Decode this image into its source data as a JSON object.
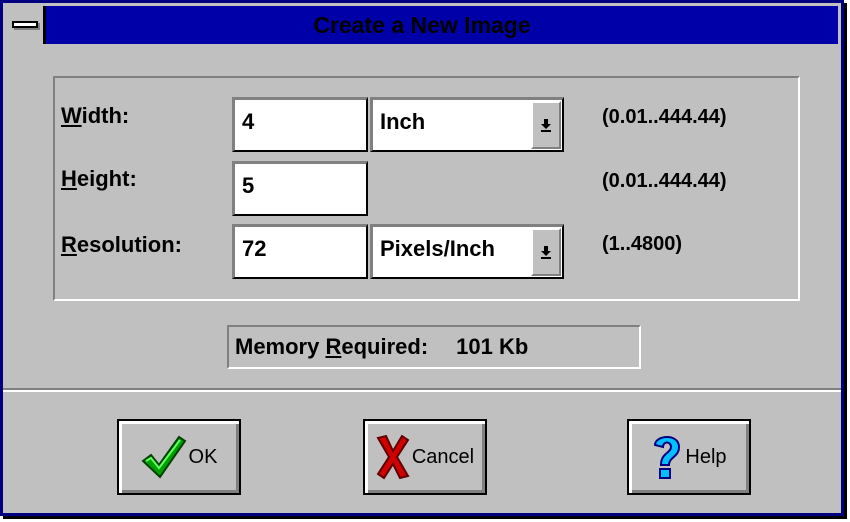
{
  "window": {
    "title": "Create a New Image"
  },
  "fields": {
    "width": {
      "label_accel": "W",
      "label_rest": "idth:",
      "value": "4",
      "unit": "Inch",
      "range": "(0.01..444.44)"
    },
    "height": {
      "label_accel": "H",
      "label_rest": "eight:",
      "value": "5",
      "range": "(0.01..444.44)"
    },
    "resolution": {
      "label_accel": "R",
      "label_rest": "esolution:",
      "value": "72",
      "unit": "Pixels/Inch",
      "range": "(1..4800)"
    }
  },
  "memory": {
    "label_before": "Memory ",
    "label_accel": "R",
    "label_after": "equired:",
    "value": "101 Kb"
  },
  "buttons": {
    "ok": "OK",
    "cancel": "Cancel",
    "help": "Help"
  },
  "icons": {
    "system_menu": "system-menu-icon",
    "dropdown": "dropdown-arrow-icon",
    "ok": "check-icon",
    "cancel": "x-icon",
    "help": "question-icon"
  },
  "colors": {
    "title_bar": "#0000a8",
    "face": "#c0c0c0",
    "check_green": "#00a000",
    "cancel_red": "#d00000",
    "help_cyan": "#00c0ff"
  }
}
